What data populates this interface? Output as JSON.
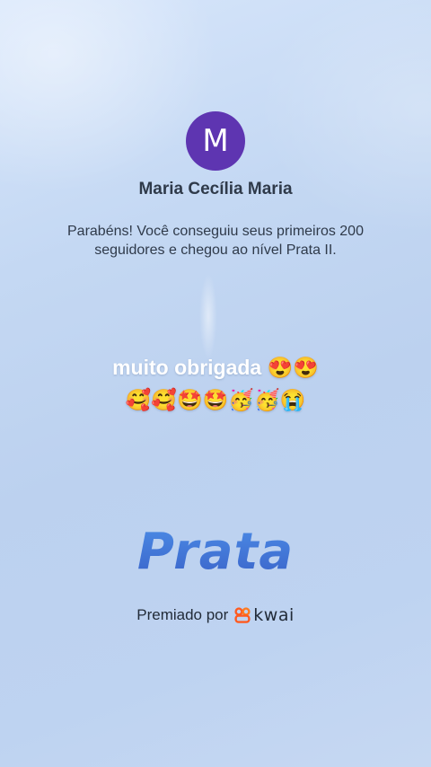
{
  "profile": {
    "avatar_initial": "M",
    "avatar_color": "#5e35b1",
    "name": "Maria Cecília Maria"
  },
  "achievement": {
    "message": "Parabéns! Você conseguiu seus primeiros 200 seguidores e chegou ao nível Prata II.",
    "level_title": "Prata",
    "awarded_by": "Premiado por",
    "brand_name": "kwai",
    "brand_color": "#ff5a1f"
  },
  "caption": {
    "text": "muito obrigada 😍😍\n🥰🥰🤩🤩🥳🥳😭"
  }
}
